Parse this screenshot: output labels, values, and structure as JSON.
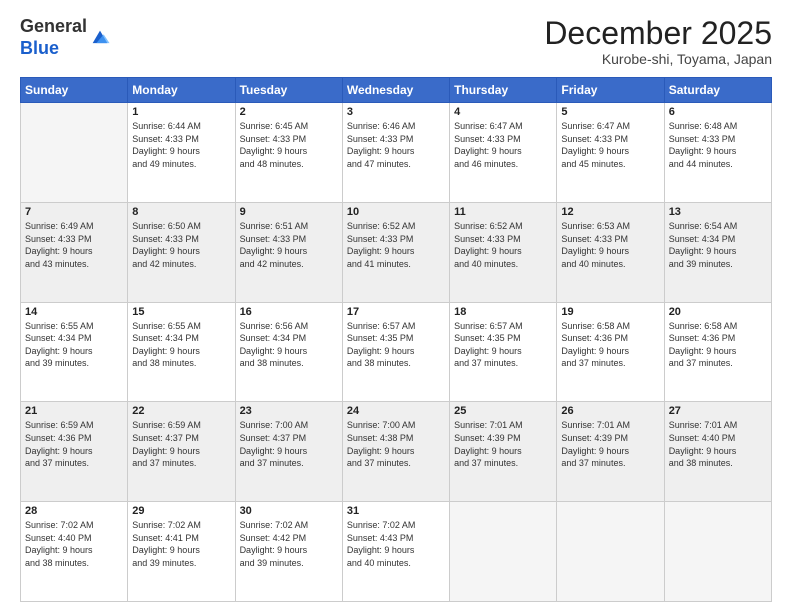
{
  "header": {
    "logo": {
      "line1": "General",
      "line2": "Blue"
    },
    "title": "December 2025",
    "subtitle": "Kurobe-shi, Toyama, Japan"
  },
  "days_of_week": [
    "Sunday",
    "Monday",
    "Tuesday",
    "Wednesday",
    "Thursday",
    "Friday",
    "Saturday"
  ],
  "weeks": [
    [
      {
        "day": "",
        "sunrise": "",
        "sunset": "",
        "daylight": ""
      },
      {
        "day": "1",
        "sunrise": "Sunrise: 6:44 AM",
        "sunset": "Sunset: 4:33 PM",
        "daylight": "Daylight: 9 hours and 49 minutes."
      },
      {
        "day": "2",
        "sunrise": "Sunrise: 6:45 AM",
        "sunset": "Sunset: 4:33 PM",
        "daylight": "Daylight: 9 hours and 48 minutes."
      },
      {
        "day": "3",
        "sunrise": "Sunrise: 6:46 AM",
        "sunset": "Sunset: 4:33 PM",
        "daylight": "Daylight: 9 hours and 47 minutes."
      },
      {
        "day": "4",
        "sunrise": "Sunrise: 6:47 AM",
        "sunset": "Sunset: 4:33 PM",
        "daylight": "Daylight: 9 hours and 46 minutes."
      },
      {
        "day": "5",
        "sunrise": "Sunrise: 6:47 AM",
        "sunset": "Sunset: 4:33 PM",
        "daylight": "Daylight: 9 hours and 45 minutes."
      },
      {
        "day": "6",
        "sunrise": "Sunrise: 6:48 AM",
        "sunset": "Sunset: 4:33 PM",
        "daylight": "Daylight: 9 hours and 44 minutes."
      }
    ],
    [
      {
        "day": "7",
        "sunrise": "Sunrise: 6:49 AM",
        "sunset": "Sunset: 4:33 PM",
        "daylight": "Daylight: 9 hours and 43 minutes."
      },
      {
        "day": "8",
        "sunrise": "Sunrise: 6:50 AM",
        "sunset": "Sunset: 4:33 PM",
        "daylight": "Daylight: 9 hours and 42 minutes."
      },
      {
        "day": "9",
        "sunrise": "Sunrise: 6:51 AM",
        "sunset": "Sunset: 4:33 PM",
        "daylight": "Daylight: 9 hours and 42 minutes."
      },
      {
        "day": "10",
        "sunrise": "Sunrise: 6:52 AM",
        "sunset": "Sunset: 4:33 PM",
        "daylight": "Daylight: 9 hours and 41 minutes."
      },
      {
        "day": "11",
        "sunrise": "Sunrise: 6:52 AM",
        "sunset": "Sunset: 4:33 PM",
        "daylight": "Daylight: 9 hours and 40 minutes."
      },
      {
        "day": "12",
        "sunrise": "Sunrise: 6:53 AM",
        "sunset": "Sunset: 4:33 PM",
        "daylight": "Daylight: 9 hours and 40 minutes."
      },
      {
        "day": "13",
        "sunrise": "Sunrise: 6:54 AM",
        "sunset": "Sunset: 4:34 PM",
        "daylight": "Daylight: 9 hours and 39 minutes."
      }
    ],
    [
      {
        "day": "14",
        "sunrise": "Sunrise: 6:55 AM",
        "sunset": "Sunset: 4:34 PM",
        "daylight": "Daylight: 9 hours and 39 minutes."
      },
      {
        "day": "15",
        "sunrise": "Sunrise: 6:55 AM",
        "sunset": "Sunset: 4:34 PM",
        "daylight": "Daylight: 9 hours and 38 minutes."
      },
      {
        "day": "16",
        "sunrise": "Sunrise: 6:56 AM",
        "sunset": "Sunset: 4:34 PM",
        "daylight": "Daylight: 9 hours and 38 minutes."
      },
      {
        "day": "17",
        "sunrise": "Sunrise: 6:57 AM",
        "sunset": "Sunset: 4:35 PM",
        "daylight": "Daylight: 9 hours and 38 minutes."
      },
      {
        "day": "18",
        "sunrise": "Sunrise: 6:57 AM",
        "sunset": "Sunset: 4:35 PM",
        "daylight": "Daylight: 9 hours and 37 minutes."
      },
      {
        "day": "19",
        "sunrise": "Sunrise: 6:58 AM",
        "sunset": "Sunset: 4:36 PM",
        "daylight": "Daylight: 9 hours and 37 minutes."
      },
      {
        "day": "20",
        "sunrise": "Sunrise: 6:58 AM",
        "sunset": "Sunset: 4:36 PM",
        "daylight": "Daylight: 9 hours and 37 minutes."
      }
    ],
    [
      {
        "day": "21",
        "sunrise": "Sunrise: 6:59 AM",
        "sunset": "Sunset: 4:36 PM",
        "daylight": "Daylight: 9 hours and 37 minutes."
      },
      {
        "day": "22",
        "sunrise": "Sunrise: 6:59 AM",
        "sunset": "Sunset: 4:37 PM",
        "daylight": "Daylight: 9 hours and 37 minutes."
      },
      {
        "day": "23",
        "sunrise": "Sunrise: 7:00 AM",
        "sunset": "Sunset: 4:37 PM",
        "daylight": "Daylight: 9 hours and 37 minutes."
      },
      {
        "day": "24",
        "sunrise": "Sunrise: 7:00 AM",
        "sunset": "Sunset: 4:38 PM",
        "daylight": "Daylight: 9 hours and 37 minutes."
      },
      {
        "day": "25",
        "sunrise": "Sunrise: 7:01 AM",
        "sunset": "Sunset: 4:39 PM",
        "daylight": "Daylight: 9 hours and 37 minutes."
      },
      {
        "day": "26",
        "sunrise": "Sunrise: 7:01 AM",
        "sunset": "Sunset: 4:39 PM",
        "daylight": "Daylight: 9 hours and 37 minutes."
      },
      {
        "day": "27",
        "sunrise": "Sunrise: 7:01 AM",
        "sunset": "Sunset: 4:40 PM",
        "daylight": "Daylight: 9 hours and 38 minutes."
      }
    ],
    [
      {
        "day": "28",
        "sunrise": "Sunrise: 7:02 AM",
        "sunset": "Sunset: 4:40 PM",
        "daylight": "Daylight: 9 hours and 38 minutes."
      },
      {
        "day": "29",
        "sunrise": "Sunrise: 7:02 AM",
        "sunset": "Sunset: 4:41 PM",
        "daylight": "Daylight: 9 hours and 39 minutes."
      },
      {
        "day": "30",
        "sunrise": "Sunrise: 7:02 AM",
        "sunset": "Sunset: 4:42 PM",
        "daylight": "Daylight: 9 hours and 39 minutes."
      },
      {
        "day": "31",
        "sunrise": "Sunrise: 7:02 AM",
        "sunset": "Sunset: 4:43 PM",
        "daylight": "Daylight: 9 hours and 40 minutes."
      },
      {
        "day": "",
        "sunrise": "",
        "sunset": "",
        "daylight": ""
      },
      {
        "day": "",
        "sunrise": "",
        "sunset": "",
        "daylight": ""
      },
      {
        "day": "",
        "sunrise": "",
        "sunset": "",
        "daylight": ""
      }
    ]
  ]
}
